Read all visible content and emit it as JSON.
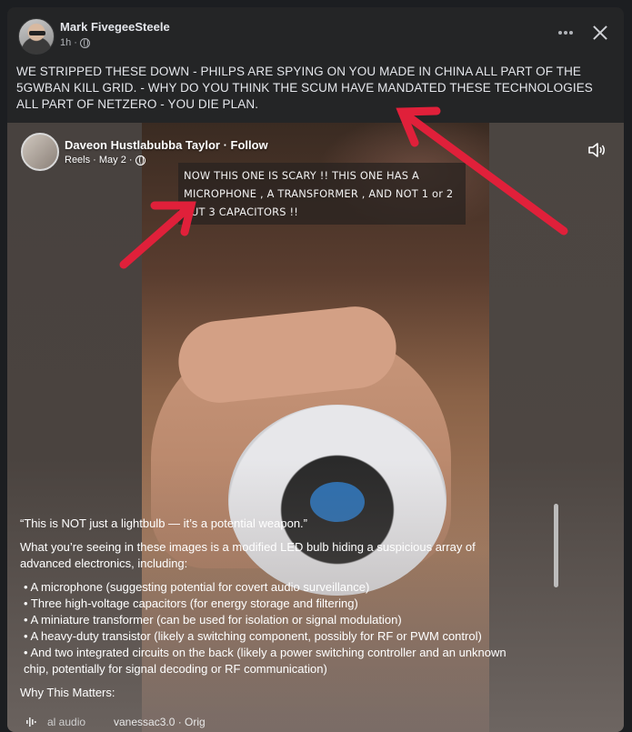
{
  "post": {
    "author": "Mark FivegeeSteele",
    "time": "1h",
    "meta_separator": "·",
    "text": "WE STRIPPED THESE DOWN - PHILPS ARE SPYING ON YOU MADE IN CHINA ALL  PART OF THE 5GWBAN KILL GRID. - WHY DO YOU THINK THE SCUM HAVE MANDATED THESE TECHNOLOGIES ALL PART OF NETZERO - YOU DIE PLAN.",
    "more_icon": "more-horizontal-icon",
    "close_icon": "close-icon",
    "privacy_icon": "globe-icon"
  },
  "reel": {
    "author": "Daveon Hustlabubba Taylor · Follow",
    "meta": "Reels · May 2 ·",
    "overlay_caption": "NOW THIS ONE IS SCARY !! THIS ONE HAS A MICROPHONE , A TRANSFORMER , AND NOT 1 or 2 BUT 3 CAPACITORS !!",
    "sound_icon": "speaker-icon",
    "description": {
      "quote": "“This is NOT just a lightbulb — it’s a potential weapon.”",
      "intro": "What you’re seeing in these images is a modified LED bulb hiding a suspicious array of advanced electronics, including:",
      "items": [
        "• A microphone (suggesting potential for covert audio surveillance)",
        "• Three high-voltage capacitors (for energy storage and filtering)",
        "• A miniature transformer (can be used for isolation or signal modulation)",
        "• A heavy-duty transistor (likely a switching component, possibly for RF or PWM control)",
        "• And two integrated circuits on the back (likely a power switching controller and an unknown chip, potentially for signal decoding or RF communication)"
      ],
      "heading": "Why This Matters:"
    },
    "audio": {
      "label": "al audio",
      "user": "vanessac3.0 · Orig"
    }
  },
  "colors": {
    "background": "#1c1e21",
    "card": "#242526",
    "text": "#e4e6eb",
    "secondary_text": "#b0b3b8",
    "arrow": "#e0203a"
  }
}
